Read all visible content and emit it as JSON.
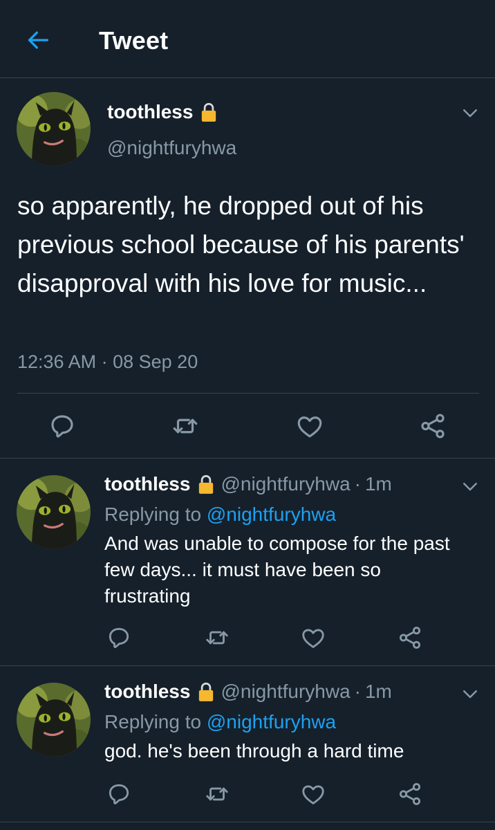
{
  "header": {
    "title": "Tweet"
  },
  "main_tweet": {
    "name": "toothless",
    "handle": "@nightfuryhwa",
    "text": "so apparently, he dropped out of his previous school because of his parents' disapproval with his love for music...",
    "time": "12:36 AM",
    "separator": "·",
    "date": "08 Sep 20"
  },
  "replies": [
    {
      "name": "toothless",
      "handle": "@nightfuryhwa",
      "dot": "·",
      "age": "1m",
      "replying_label": "Replying to",
      "replying_to": "@nightfuryhwa",
      "text": "And was unable to compose for the past few days... it must have been so frustrating"
    },
    {
      "name": "toothless",
      "handle": "@nightfuryhwa",
      "dot": "·",
      "age": "1m",
      "replying_label": "Replying to",
      "replying_to": "@nightfuryhwa",
      "text": "god. he's been through a hard time"
    }
  ],
  "icons": {
    "back": "arrow-left-icon",
    "lock": "lock-icon",
    "chevron": "chevron-down-icon",
    "reply": "reply-icon",
    "retweet": "retweet-icon",
    "like": "heart-icon",
    "share": "share-icon"
  },
  "colors": {
    "background": "#15202b",
    "accent": "#1da1f2",
    "secondary_text": "#8899a6",
    "divider": "#38444d",
    "lock": "#f5b82e"
  }
}
